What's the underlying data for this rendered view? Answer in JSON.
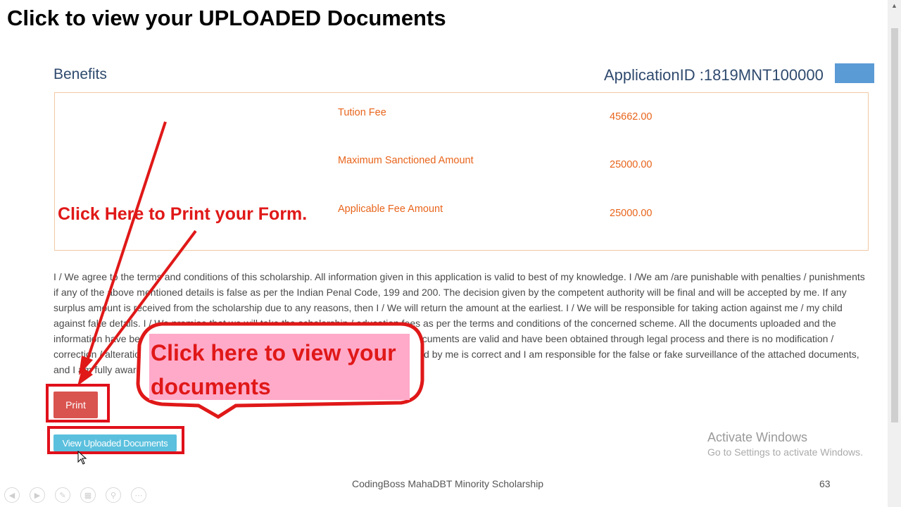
{
  "slide": {
    "title": "Click to view your UPLOADED Documents",
    "footer": "CodingBoss MahaDBT Minority Scholarship",
    "page_number": "63"
  },
  "form": {
    "benefits_heading": "Benefits",
    "application_id": "ApplicationID :1819MNT100000",
    "fees": [
      {
        "label": "Tution Fee",
        "value": "45662.00"
      },
      {
        "label": "Maximum Sanctioned Amount",
        "value": "25000.00"
      },
      {
        "label": "Applicable Fee Amount",
        "value": "25000.00"
      }
    ],
    "declaration": "I / We agree to the terms and conditions of this scholarship. All information given in this application is valid to best of my knowledge. I /We am /are punishable with penalties / punishments if any of the above mentioned details is false as per the Indian Penal Code, 199 and 200. The decision given by the competent authority will be final and will be accepted by me. If any surplus amount is received from the scholarship due to any reasons, then I / We will return the amount at the earliest. I / We will be responsible for taking action against me / my child against fake details. I / We promise that we will take the scholarship / education fees as per the terms and conditions of the concerned scheme. All the documents uploaded and the information have been received from the competent authority / authorities and the documents are valid and have been obtained through legal process and there is no modification / correction / alteration performed on them. I hereby certify that the information provided by me is correct and I am responsible for the false or fake surveillance of the attached documents, and I am fully aware that I will be entitled to the benefit.",
    "print_label": "Print",
    "view_docs_label": "View Uploaded Documents"
  },
  "annotations": {
    "print_note": "Click Here to Print your Form.",
    "view_note": "Click here to view your documents",
    "annotation_color": "#e01818"
  },
  "watermark": {
    "title": "Activate Windows",
    "subtitle": "Go to Settings to activate Windows."
  },
  "nav_icons": [
    "back-icon",
    "play-icon",
    "pen-icon",
    "slides-icon",
    "zoom-icon",
    "more-icon"
  ],
  "colors": {
    "print_button": "#d9534f",
    "view_button": "#5bc0de",
    "fee_text": "#e8641b",
    "heading_text": "#2f4a6e"
  }
}
